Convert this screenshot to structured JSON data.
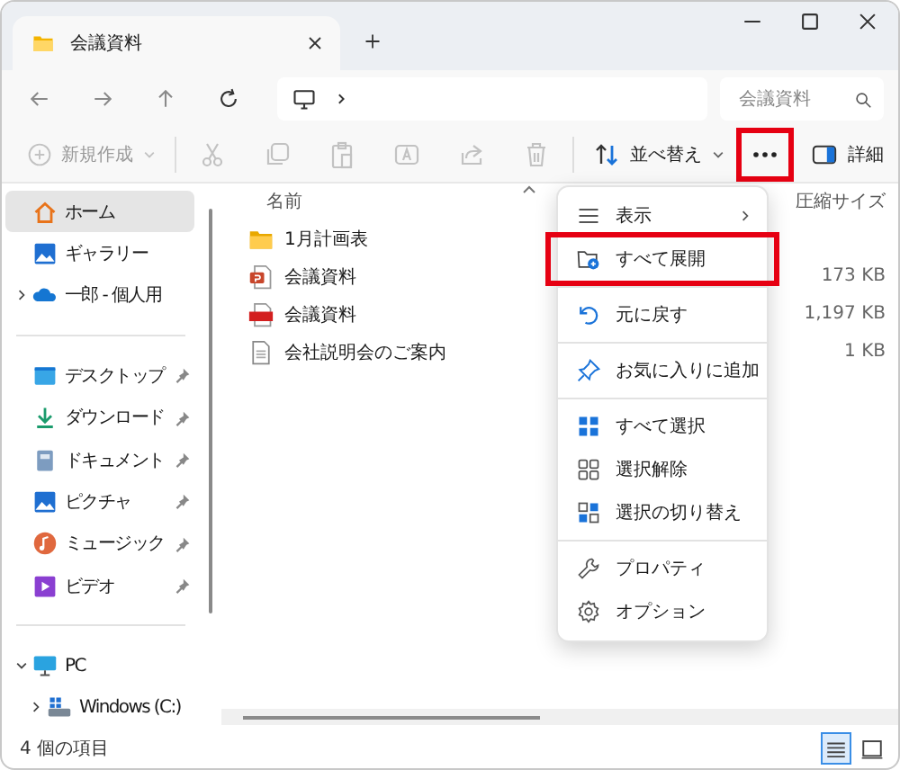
{
  "tab": {
    "title": "会議資料"
  },
  "address_bar": {
    "search_placeholder": "会議資料"
  },
  "toolbar": {
    "new_button": {
      "label": "新規作成",
      "disabled": true
    },
    "actions": [
      {
        "disabled": true
      },
      {
        "disabled": true
      },
      {
        "disabled": true
      },
      {
        "disabled": true
      },
      {
        "disabled": true
      },
      {
        "disabled": true
      }
    ],
    "sort_button": {
      "label": "並べ替え"
    },
    "more_button": {
      "highlighted": true
    },
    "details_button": {
      "label": "詳細"
    }
  },
  "sidebar": {
    "groups": [
      [
        {
          "label": "ホーム",
          "selected": true,
          "pinned": false
        },
        {
          "label": "ギャラリー",
          "selected": false,
          "pinned": false
        },
        {
          "label": "一郎 - 個人用",
          "selected": false,
          "pinned": false,
          "expanded": false
        }
      ],
      [
        {
          "label": "デスクトップ",
          "selected": false,
          "pinned": true
        },
        {
          "label": "ダウンロード",
          "selected": false,
          "pinned": true
        },
        {
          "label": "ドキュメント",
          "selected": false,
          "pinned": true
        },
        {
          "label": "ピクチャ",
          "selected": false,
          "pinned": true
        },
        {
          "label": "ミュージック",
          "selected": false,
          "pinned": true
        },
        {
          "label": "ビデオ",
          "selected": false,
          "pinned": true
        }
      ],
      [
        {
          "label": "PC",
          "selected": false,
          "pinned": false,
          "expanded": true,
          "children": [
            {
              "label": "Windows (C:)",
              "selected": false,
              "pinned": false,
              "expanded": false
            }
          ]
        }
      ]
    ]
  },
  "file_list": {
    "columns": [
      {
        "label": "名前",
        "sorted": true
      },
      {
        "label": "圧縮サイズ",
        "sorted": false
      }
    ],
    "rows": [
      {
        "kind": "folder",
        "name": "1月計画表",
        "size": ""
      },
      {
        "kind": "slides",
        "name": "会議資料",
        "size": "173 KB"
      },
      {
        "kind": "pdf",
        "name": "会議資料",
        "size": "1,197 KB"
      },
      {
        "kind": "document",
        "name": "会社説明会のご案内",
        "size": "1 KB"
      }
    ]
  },
  "context_menu": {
    "groups": [
      [
        {
          "label": "表示",
          "submenu": true,
          "highlighted": false
        },
        {
          "label": "すべて展開",
          "submenu": false,
          "highlighted": true
        }
      ],
      [
        {
          "label": "元に戻す",
          "submenu": false,
          "highlighted": false
        }
      ],
      [
        {
          "label": "お気に入りに追加",
          "submenu": false,
          "highlighted": false
        }
      ],
      [
        {
          "label": "すべて選択",
          "submenu": false,
          "highlighted": false
        },
        {
          "label": "選択解除",
          "submenu": false,
          "highlighted": false
        },
        {
          "label": "選択の切り替え",
          "submenu": false,
          "highlighted": false
        }
      ],
      [
        {
          "label": "プロパティ",
          "submenu": false,
          "highlighted": false
        },
        {
          "label": "オプション",
          "submenu": false,
          "highlighted": false
        }
      ]
    ]
  },
  "status_bar": {
    "text": "4 個の項目",
    "views": [
      {
        "selected": true
      },
      {
        "selected": false
      }
    ]
  }
}
